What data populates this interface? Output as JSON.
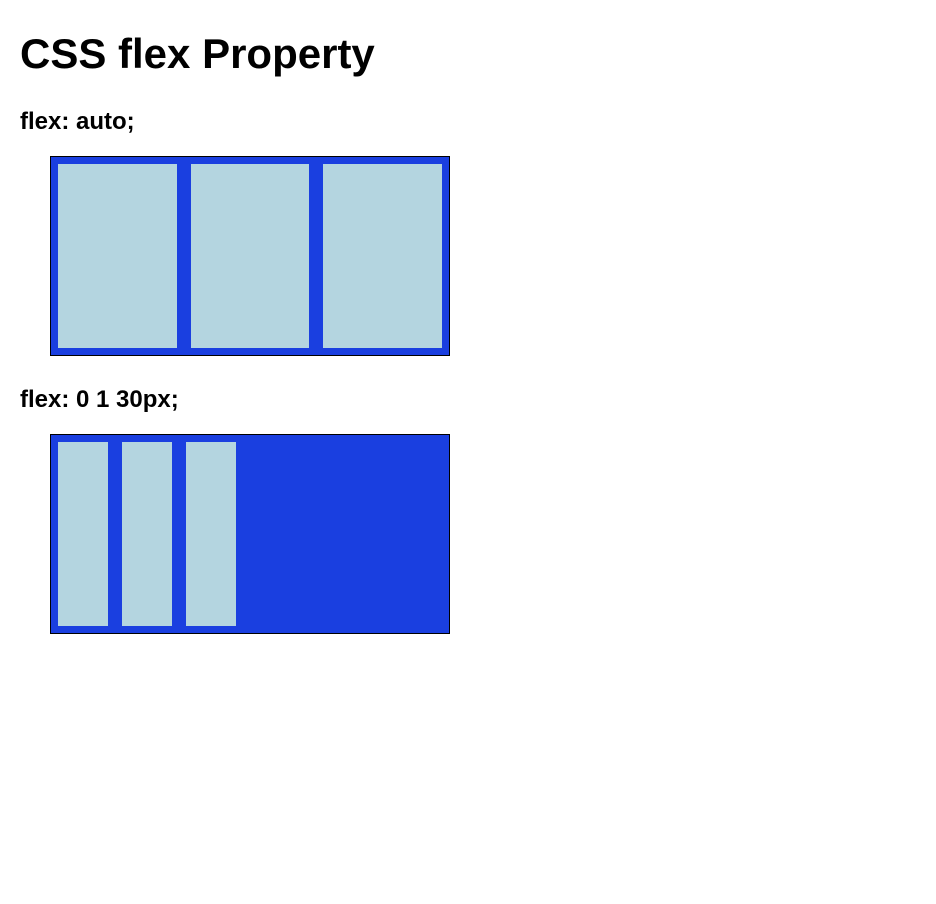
{
  "title": "CSS flex Property",
  "examples": [
    {
      "label": "flex: auto;",
      "flex_value": "auto",
      "items": 3
    },
    {
      "label": "flex: 0 1 30px;",
      "flex_value": "0 1 30px",
      "items": 3
    }
  ],
  "colors": {
    "container_bg": "#1a3fe0",
    "item_bg": "#b4d5e0"
  }
}
